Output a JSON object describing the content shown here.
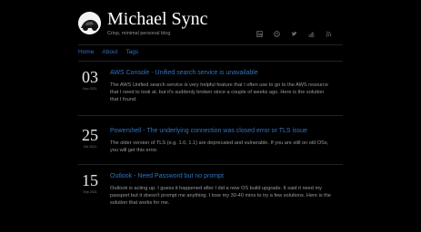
{
  "site": {
    "title": "Michael Sync",
    "tagline": "Crisp, minimal personal blog"
  },
  "social_icons": [
    "linkedin-icon",
    "github-icon",
    "twitter-icon",
    "stackoverflow-icon",
    "rss-icon"
  ],
  "nav": [
    "Home",
    "About",
    "Tags"
  ],
  "posts": [
    {
      "day": "03",
      "month": "Nov 2021",
      "title": "AWS Console - Unified search service is unavailable",
      "excerpt": "The AWS Unified search service is very helpful feature that I often use to go to the AWS resource that I need to look at. but it's suddenly broken since a couple of weeks ago. Here is the solution that I found."
    },
    {
      "day": "25",
      "month": "Oct 2021",
      "title": "Powershell - The underlying connection was closed error or TLS issue",
      "excerpt": "The older version of TLS (e.g. 1.0, 1.1) are deprecated and vulnerable. If you are still on old OSs, you will get this error."
    },
    {
      "day": "15",
      "month": "Sep 2021",
      "title": "Outlook - Need Password but no prompt",
      "excerpt": "Outlook is acting up. I guess it happened after I did a new OS build upgrade. It said it need my passport but it doesn't prompt me anything. I lose my 30-40 mins to try a few solutions. Here is the solution that works for me."
    }
  ],
  "colors": {
    "background": "#000000",
    "link": "#2f74c0",
    "text": "#9a9a9a"
  }
}
